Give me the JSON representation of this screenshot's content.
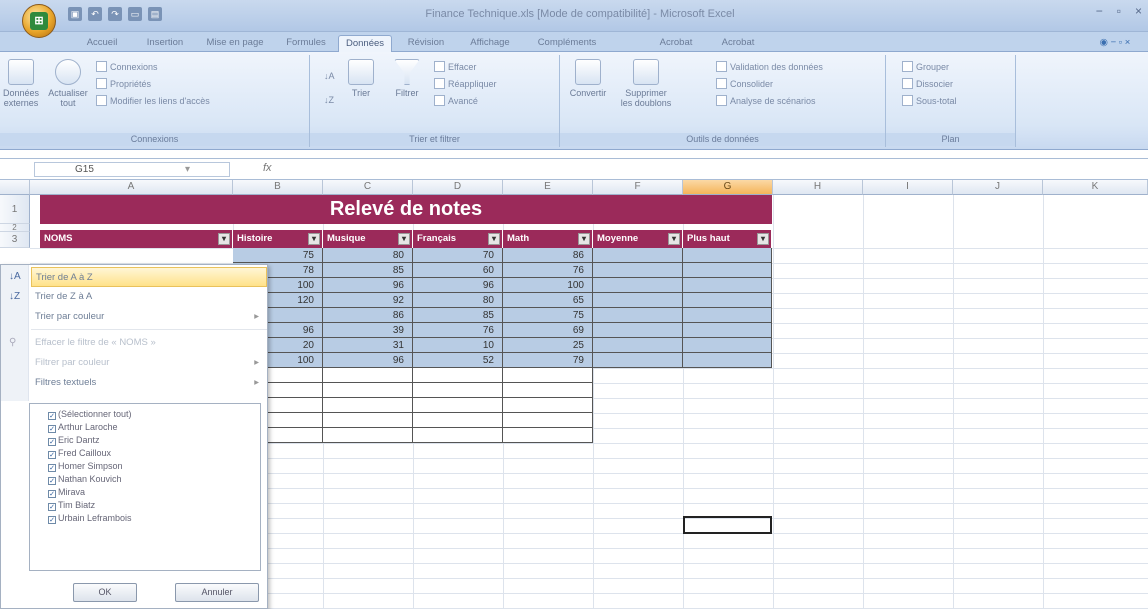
{
  "app": {
    "title": "Finance Technique.xls [Mode de compatibilité] - Microsoft Excel",
    "logo": "office-logo",
    "win_controls": [
      "−",
      "▫",
      "×"
    ]
  },
  "qat": [
    "save-icon",
    "undo-icon",
    "redo-icon",
    "folder-icon",
    "print-icon"
  ],
  "tabs": [
    "Accueil",
    "Insertion",
    "Mise en page",
    "Formules",
    "Données",
    "Révision",
    "Affichage",
    "Compléments",
    "Acrobat",
    "Acrobat"
  ],
  "active_tab": "Données",
  "ribbon": {
    "groups": [
      {
        "label": "Connexions"
      },
      {
        "label": "Trier et filtrer"
      },
      {
        "label": "Outils de données"
      },
      {
        "label": "Plan"
      }
    ],
    "big_buttons": [
      "Données externes",
      "Actualiser tout",
      "Trier",
      "Filtrer",
      "Convertir",
      "Supprimer les doublons"
    ],
    "small_buttons": [
      "Connexions",
      "Propriétés",
      "Modifier les liens d'accès",
      "Effacer",
      "Réappliquer",
      "Avancé",
      "Validation des données",
      "Consolider",
      "Analyse de scénarios",
      "Grouper",
      "Dissocier",
      "Sous-total"
    ]
  },
  "formula_bar": {
    "name_box": "G15",
    "fx": "fx",
    "value": ""
  },
  "columns": [
    "A",
    "B",
    "C",
    "D",
    "E",
    "F",
    "G",
    "H",
    "I",
    "J",
    "K"
  ],
  "rows": [
    "1",
    "2",
    "3"
  ],
  "sheet": {
    "title": "Relevé de notes",
    "headers": [
      "NOMS",
      "Histoire",
      "Musique",
      "Français",
      "Math",
      "Moyenne",
      "Plus haut"
    ],
    "data": [
      [
        "75",
        "80",
        "70",
        "86"
      ],
      [
        "78",
        "85",
        "60",
        "76"
      ],
      [
        "100",
        "96",
        "96",
        "100"
      ],
      [
        "120",
        "92",
        "80",
        "65"
      ],
      [
        "",
        "86",
        "85",
        "75"
      ],
      [
        "96",
        "39",
        "76",
        "69"
      ],
      [
        "20",
        "31",
        "10",
        "25"
      ],
      [
        "100",
        "96",
        "52",
        "79"
      ]
    ]
  },
  "filter_menu": {
    "items": [
      {
        "label": "Trier de A à Z",
        "icon": "sort-az-icon"
      },
      {
        "label": "Trier de Z à A",
        "icon": "sort-za-icon"
      },
      {
        "label": "Trier par couleur"
      },
      {
        "label": "Effacer le filtre de « NOMS »",
        "icon": "clear-filter-icon"
      },
      {
        "label": "Filtrer par couleur"
      },
      {
        "label": "Filtres textuels"
      }
    ],
    "checklist": [
      "(Sélectionner tout)",
      "Arthur Laroche",
      "Eric Dantz",
      "Fred Cailloux",
      "Homer Simpson",
      "Nathan Kouvich",
      "Mirava",
      "Tim Biatz",
      "Urbain Leframbois"
    ],
    "ok": "OK",
    "cancel": "Annuler"
  },
  "colors": {
    "header_fill": "#9b2a5a",
    "band_blue": "#b8cce4",
    "ribbon": "#d9e6f6"
  }
}
